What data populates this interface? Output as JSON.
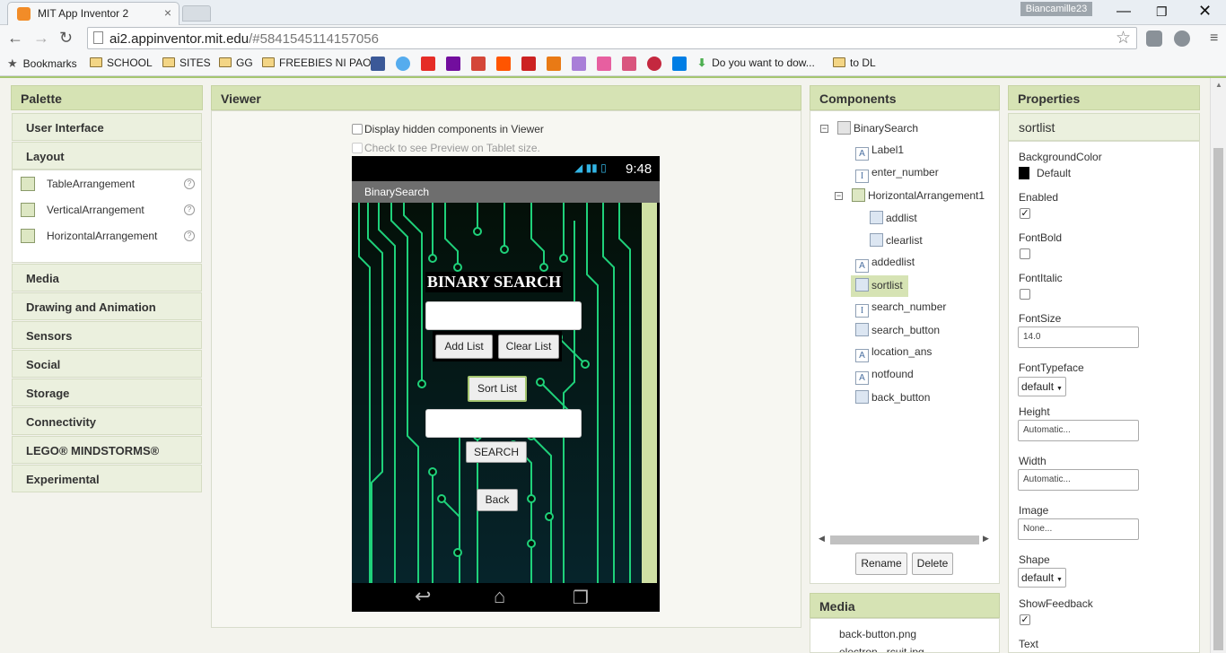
{
  "browser": {
    "tab_title": "MIT App Inventor 2",
    "profile_name": "Biancamille23",
    "url_host": "ai2.appinventor.mit.edu",
    "url_rest": "/#5841545114157056",
    "bookmarks": [
      "Bookmarks",
      "SCHOOL",
      "SITES",
      "GG",
      "FREEBIES NI PAO",
      "Do you want to dow...",
      "to DL"
    ]
  },
  "palette": {
    "title": "Palette",
    "categories_top": [
      "User Interface",
      "Layout"
    ],
    "layout_items": [
      "TableArrangement",
      "VerticalArrangement",
      "HorizontalArrangement"
    ],
    "categories_bottom": [
      "Media",
      "Drawing and Animation",
      "Sensors",
      "Social",
      "Storage",
      "Connectivity",
      "LEGO® MINDSTORMS®",
      "Experimental"
    ]
  },
  "viewer": {
    "title": "Viewer",
    "display_hidden": "Display hidden components in Viewer",
    "tablet_preview": "Check to see Preview on Tablet size.",
    "clock": "9:48",
    "screen_title": "BinarySearch",
    "app_heading": "BINARY SEARCH",
    "add_list": "Add List",
    "clear_list": "Clear List",
    "sort_list": "Sort List",
    "search": "SEARCH",
    "back": "Back"
  },
  "components": {
    "title": "Components",
    "root": "BinarySearch",
    "items": [
      "Label1",
      "enter_number",
      "HorizontalArrangement1",
      "addlist",
      "clearlist",
      "addedlist",
      "sortlist",
      "search_number",
      "search_button",
      "location_ans",
      "notfound",
      "back_button"
    ],
    "rename": "Rename",
    "delete": "Delete"
  },
  "media": {
    "title": "Media",
    "files": [
      "back-button.png",
      "electron...rcuit.jpg"
    ]
  },
  "properties": {
    "title": "Properties",
    "component": "sortlist",
    "background_color_label": "BackgroundColor",
    "background_color_value": "Default",
    "enabled_label": "Enabled",
    "fontbold_label": "FontBold",
    "fontitalic_label": "FontItalic",
    "fontsize_label": "FontSize",
    "fontsize_value": "14.0",
    "fonttypeface_label": "FontTypeface",
    "fonttypeface_value": "default",
    "height_label": "Height",
    "height_value": "Automatic...",
    "width_label": "Width",
    "width_value": "Automatic...",
    "image_label": "Image",
    "image_value": "None...",
    "shape_label": "Shape",
    "shape_value": "default",
    "showfeedback_label": "ShowFeedback",
    "text_label": "Text",
    "enabled_checked": true,
    "fontbold_checked": false,
    "fontitalic_checked": false,
    "showfeedback_checked": true
  },
  "colors": {
    "panel_header": "#d6e3b4",
    "accent_green": "#a5c670"
  }
}
